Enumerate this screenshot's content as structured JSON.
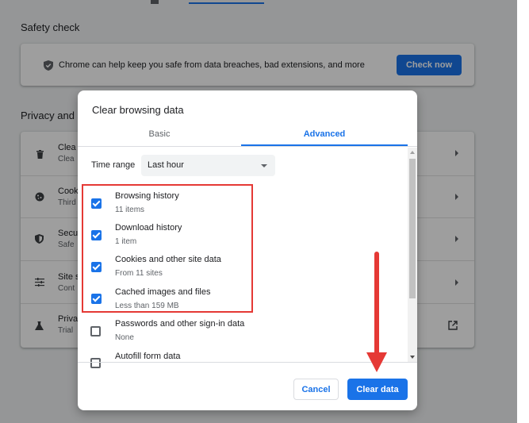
{
  "background": {
    "safety_check": {
      "title": "Safety check",
      "card_text": "Chrome can help keep you safe from data breaches, bad extensions, and more",
      "check_now_label": "Check now"
    },
    "privacy": {
      "title": "Privacy and s",
      "rows": [
        {
          "icon": "trash-icon",
          "title": "Clea",
          "sub": "Clea"
        },
        {
          "icon": "cookie-icon",
          "title": "Cook",
          "sub": "Third"
        },
        {
          "icon": "shield-icon",
          "title": "Secu",
          "sub": "Safe"
        },
        {
          "icon": "tune-icon",
          "title": "Site s",
          "sub": "Cont"
        },
        {
          "icon": "flask-icon",
          "title": "Priva",
          "sub": "Trial"
        }
      ]
    }
  },
  "dialog": {
    "title": "Clear browsing data",
    "tabs": {
      "basic": "Basic",
      "advanced": "Advanced"
    },
    "time_range": {
      "label": "Time range",
      "value": "Last hour"
    },
    "items": [
      {
        "title": "Browsing history",
        "sub": "11 items",
        "checked": true
      },
      {
        "title": "Download history",
        "sub": "1 item",
        "checked": true
      },
      {
        "title": "Cookies and other site data",
        "sub": "From 11 sites",
        "checked": true
      },
      {
        "title": "Cached images and files",
        "sub": "Less than 159 MB",
        "checked": true
      },
      {
        "title": "Passwords and other sign-in data",
        "sub": "None",
        "checked": false
      },
      {
        "title": "Autofill form data",
        "sub": "",
        "checked": false
      }
    ],
    "cancel_label": "Cancel",
    "clear_label": "Clear data"
  },
  "colors": {
    "accent": "#1a73e8",
    "annotation": "#e53935"
  }
}
